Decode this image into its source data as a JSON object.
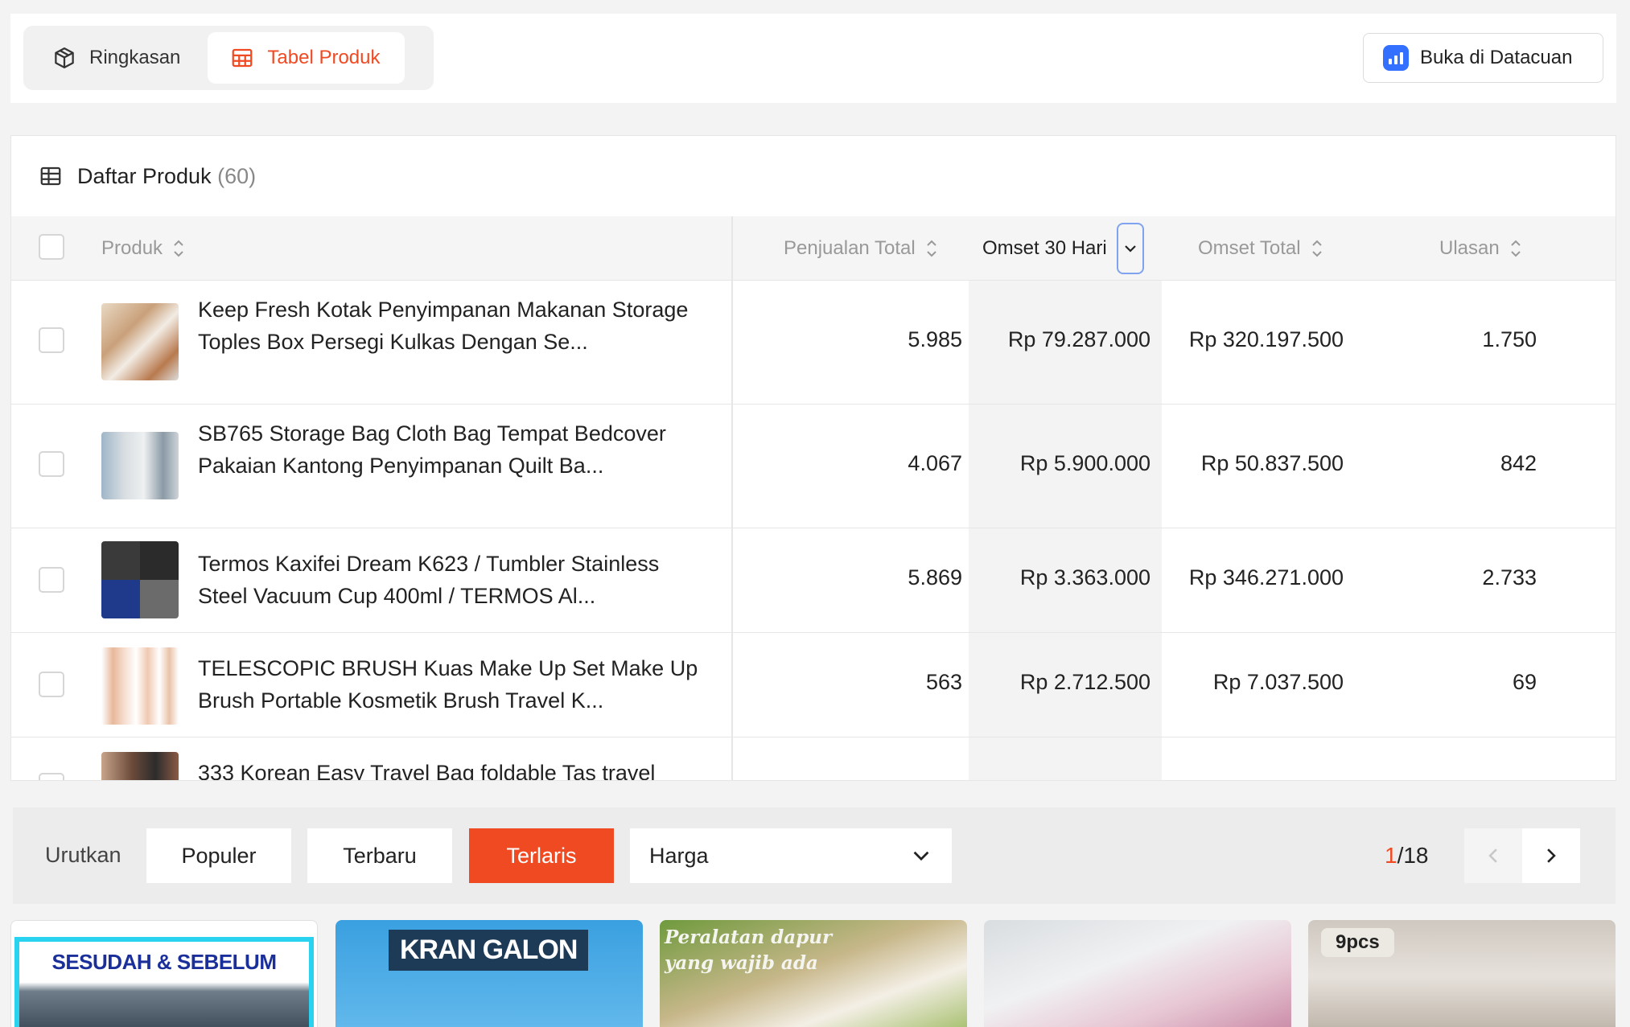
{
  "tabs": [
    {
      "label": "Ringkasan",
      "icon": "package-icon",
      "active": false
    },
    {
      "label": "Tabel Produk",
      "icon": "table-icon",
      "active": true
    }
  ],
  "open_button": {
    "label": "Buka di Datacuan",
    "icon": "bar-chart-icon"
  },
  "panel": {
    "title": "Daftar Produk",
    "count": "(60)"
  },
  "columns": {
    "product": "Produk",
    "total_sales": "Penjualan Total",
    "revenue_30d": "Omset 30 Hari",
    "total_revenue": "Omset Total",
    "reviews": "Ulasan"
  },
  "rows": [
    {
      "name": "Keep Fresh Kotak Penyimpanan Makanan Storage Toples Box Persegi Kulkas Dengan Se...",
      "total_sales": "5.985",
      "revenue_30d": "Rp 79.287.000",
      "total_revenue": "Rp 320.197.500",
      "reviews": "1.750"
    },
    {
      "name": "SB765 Storage Bag Cloth Bag Tempat Bedcover Pakaian Kantong Penyimpanan Quilt Ba...",
      "total_sales": "4.067",
      "revenue_30d": "Rp 5.900.000",
      "total_revenue": "Rp 50.837.500",
      "reviews": "842"
    },
    {
      "name": "Termos Kaxifei Dream K623 / Tumbler Stainless Steel Vacuum Cup 400ml / TERMOS Al...",
      "total_sales": "5.869",
      "revenue_30d": "Rp 3.363.000",
      "total_revenue": "Rp 346.271.000",
      "reviews": "2.733"
    },
    {
      "name": "TELESCOPIC BRUSH Kuas Make Up Set Make Up Brush Portable Kosmetik Brush Travel K...",
      "total_sales": "563",
      "revenue_30d": "Rp 2.712.500",
      "total_revenue": "Rp 7.037.500",
      "reviews": "69"
    },
    {
      "name": "333 Korean Easy Travel Bag foldable Tas travel",
      "total_sales": "",
      "revenue_30d": "",
      "total_revenue": "",
      "reviews": ""
    }
  ],
  "sortbar": {
    "label": "Urutkan",
    "options": [
      "Populer",
      "Terbaru",
      "Terlaris"
    ],
    "active": "Terlaris",
    "price_select": "Harga",
    "page_current": "1",
    "page_total": "/18"
  },
  "cards": [
    {
      "caption": "SESUDAH & SEBELUM"
    },
    {
      "caption": "KRAN GALON"
    },
    {
      "caption": "Peralatan dapur yang wajib ada"
    },
    {
      "caption": ""
    },
    {
      "caption": "9pcs"
    }
  ],
  "colors": {
    "accent": "#f04a23",
    "brand_blue": "#3370ff",
    "highlight_col": "#f3f3f3"
  }
}
